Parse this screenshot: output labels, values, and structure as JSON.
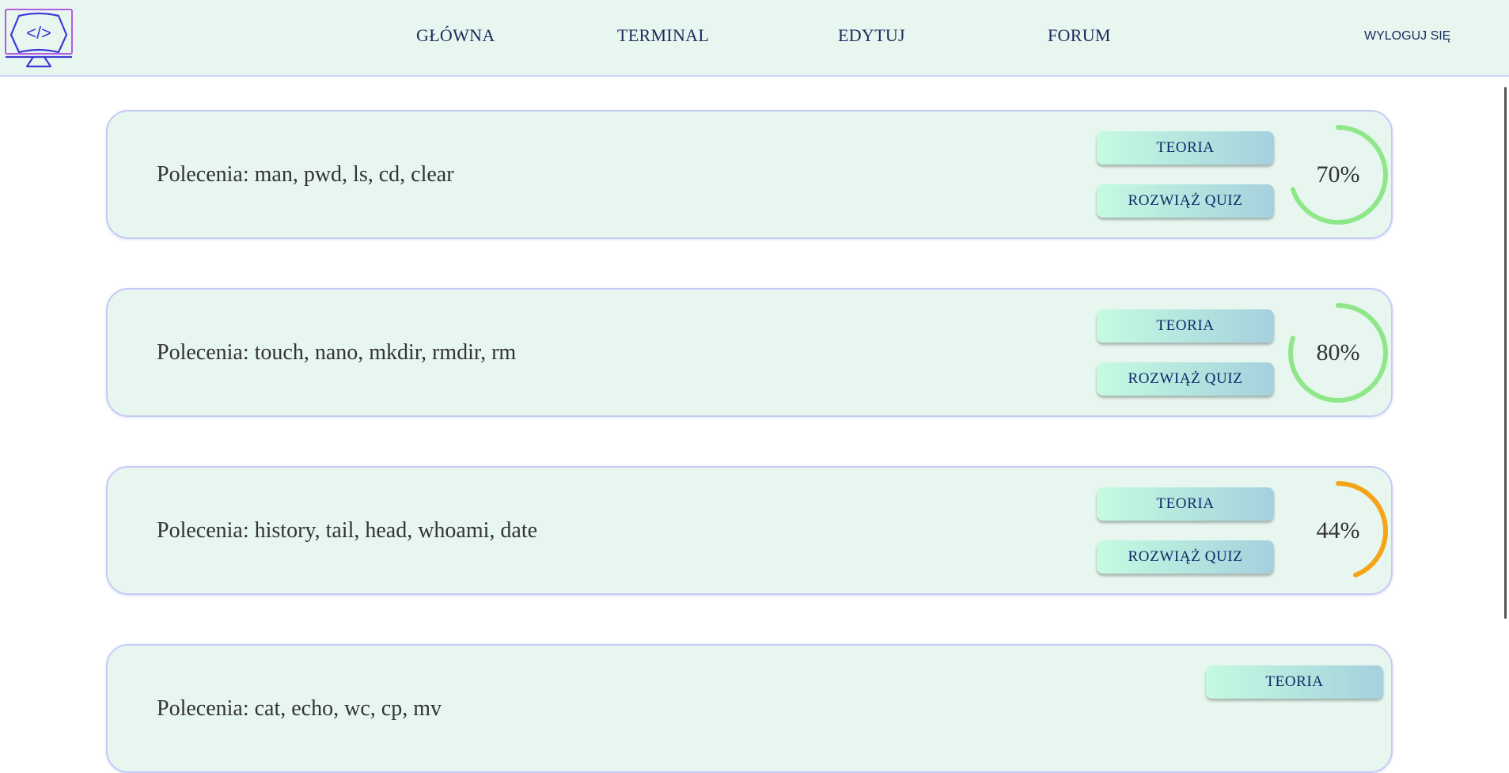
{
  "header": {
    "logo_glyph": "</>",
    "nav": [
      {
        "label": "GŁÓWNA"
      },
      {
        "label": "TERMINAL"
      },
      {
        "label": "EDYTUJ"
      },
      {
        "label": "FORUM"
      }
    ],
    "logout_label": "WYLOGUJ SIĘ"
  },
  "colors": {
    "header_bg": "#e7f7f0",
    "card_bg": "#e7f7f0",
    "progress_good": "#90e78a",
    "progress_mid": "#f5a418",
    "nav_text": "#1a2a5e"
  },
  "lessons": [
    {
      "title": "Polecenia: man, pwd, ls, cd, clear",
      "theory_label": "TEORIA",
      "quiz_label": "ROZWIĄŻ QUIZ",
      "progress_text": "70%",
      "progress": 0.7,
      "progress_color": "#90e78a"
    },
    {
      "title": "Polecenia: touch, nano, mkdir, rmdir, rm",
      "theory_label": "TEORIA",
      "quiz_label": "ROZWIĄŻ QUIZ",
      "progress_text": "80%",
      "progress": 0.8,
      "progress_color": "#90e78a"
    },
    {
      "title": "Polecenia: history, tail, head, whoami, date",
      "theory_label": "TEORIA",
      "quiz_label": "ROZWIĄŻ QUIZ",
      "progress_text": "44%",
      "progress": 0.44,
      "progress_color": "#f5a418"
    },
    {
      "title": "Polecenia: cat, echo, wc, cp, mv",
      "theory_label": "TEORIA"
    }
  ]
}
